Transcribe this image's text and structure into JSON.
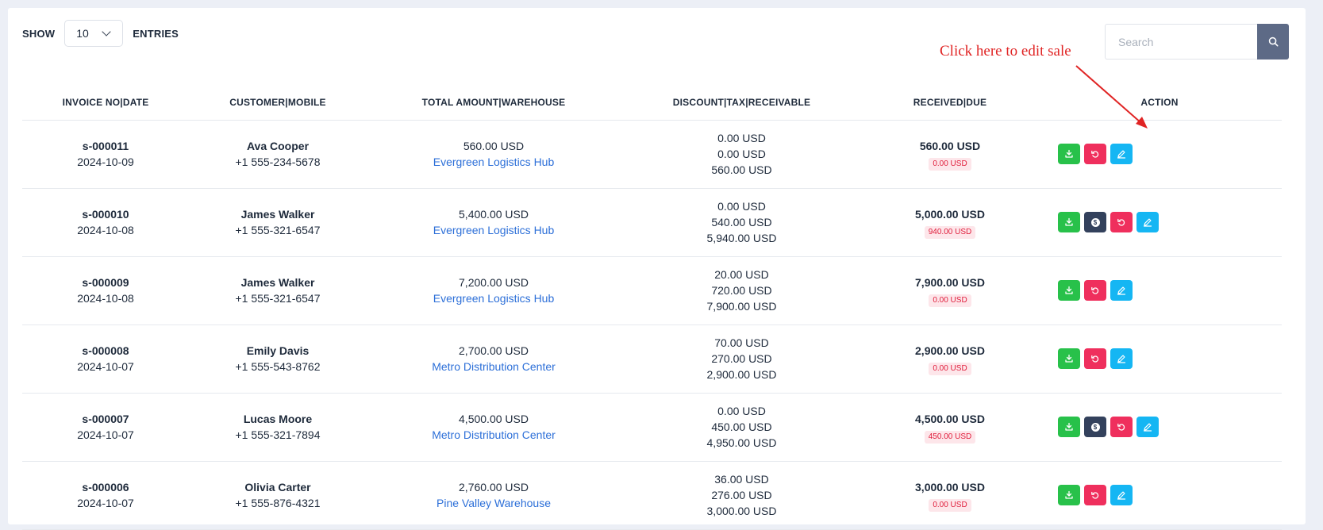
{
  "controls": {
    "show_label": "SHOW",
    "entries_value": "10",
    "entries_label": "ENTRIES",
    "search_placeholder": "Search"
  },
  "annotation": {
    "text": "Click here to edit sale",
    "color": "#e02424"
  },
  "columns": {
    "invoice": "INVOICE NO|DATE",
    "customer": "CUSTOMER|MOBILE",
    "total": "TOTAL AMOUNT|WAREHOUSE",
    "discount": "DISCOUNT|TAX|RECEIVABLE",
    "received": "RECEIVED|DUE",
    "action": "ACTION"
  },
  "rows": [
    {
      "invoice": "s-000011",
      "date": "2024-10-09",
      "customer": "Ava Cooper",
      "mobile": "+1 555-234-5678",
      "total": "560.00 USD",
      "warehouse": "Evergreen Logistics Hub",
      "discount": "0.00 USD",
      "tax": "0.00 USD",
      "receivable": "560.00 USD",
      "received": "560.00 USD",
      "due": "0.00 USD",
      "has_payment": false
    },
    {
      "invoice": "s-000010",
      "date": "2024-10-08",
      "customer": "James Walker",
      "mobile": "+1 555-321-6547",
      "total": "5,400.00 USD",
      "warehouse": "Evergreen Logistics Hub",
      "discount": "0.00 USD",
      "tax": "540.00 USD",
      "receivable": "5,940.00 USD",
      "received": "5,000.00 USD",
      "due": "940.00 USD",
      "has_payment": true
    },
    {
      "invoice": "s-000009",
      "date": "2024-10-08",
      "customer": "James Walker",
      "mobile": "+1 555-321-6547",
      "total": "7,200.00 USD",
      "warehouse": "Evergreen Logistics Hub",
      "discount": "20.00 USD",
      "tax": "720.00 USD",
      "receivable": "7,900.00 USD",
      "received": "7,900.00 USD",
      "due": "0.00 USD",
      "has_payment": false
    },
    {
      "invoice": "s-000008",
      "date": "2024-10-07",
      "customer": "Emily Davis",
      "mobile": "+1 555-543-8762",
      "total": "2,700.00 USD",
      "warehouse": "Metro Distribution Center",
      "discount": "70.00 USD",
      "tax": "270.00 USD",
      "receivable": "2,900.00 USD",
      "received": "2,900.00 USD",
      "due": "0.00 USD",
      "has_payment": false
    },
    {
      "invoice": "s-000007",
      "date": "2024-10-07",
      "customer": "Lucas Moore",
      "mobile": "+1 555-321-7894",
      "total": "4,500.00 USD",
      "warehouse": "Metro Distribution Center",
      "discount": "0.00 USD",
      "tax": "450.00 USD",
      "receivable": "4,950.00 USD",
      "received": "4,500.00 USD",
      "due": "450.00 USD",
      "has_payment": true
    },
    {
      "invoice": "s-000006",
      "date": "2024-10-07",
      "customer": "Olivia Carter",
      "mobile": "+1 555-876-4321",
      "total": "2,760.00 USD",
      "warehouse": "Pine Valley Warehouse",
      "discount": "36.00 USD",
      "tax": "276.00 USD",
      "receivable": "3,000.00 USD",
      "received": "3,000.00 USD",
      "due": "0.00 USD",
      "has_payment": false
    }
  ],
  "icons": {
    "download": "download-icon",
    "payment": "payment-icon",
    "return": "return-icon",
    "edit": "edit-icon",
    "search": "search-icon",
    "dropdown": "chevron-down-icon"
  },
  "colors": {
    "download_btn": "#28c14a",
    "payment_btn": "#33415c",
    "return_btn": "#ef2f5d",
    "edit_btn": "#15b6f3",
    "link": "#2c6fd8",
    "due_badge_text": "#e01e3c",
    "due_badge_bg": "#fde6ea"
  }
}
